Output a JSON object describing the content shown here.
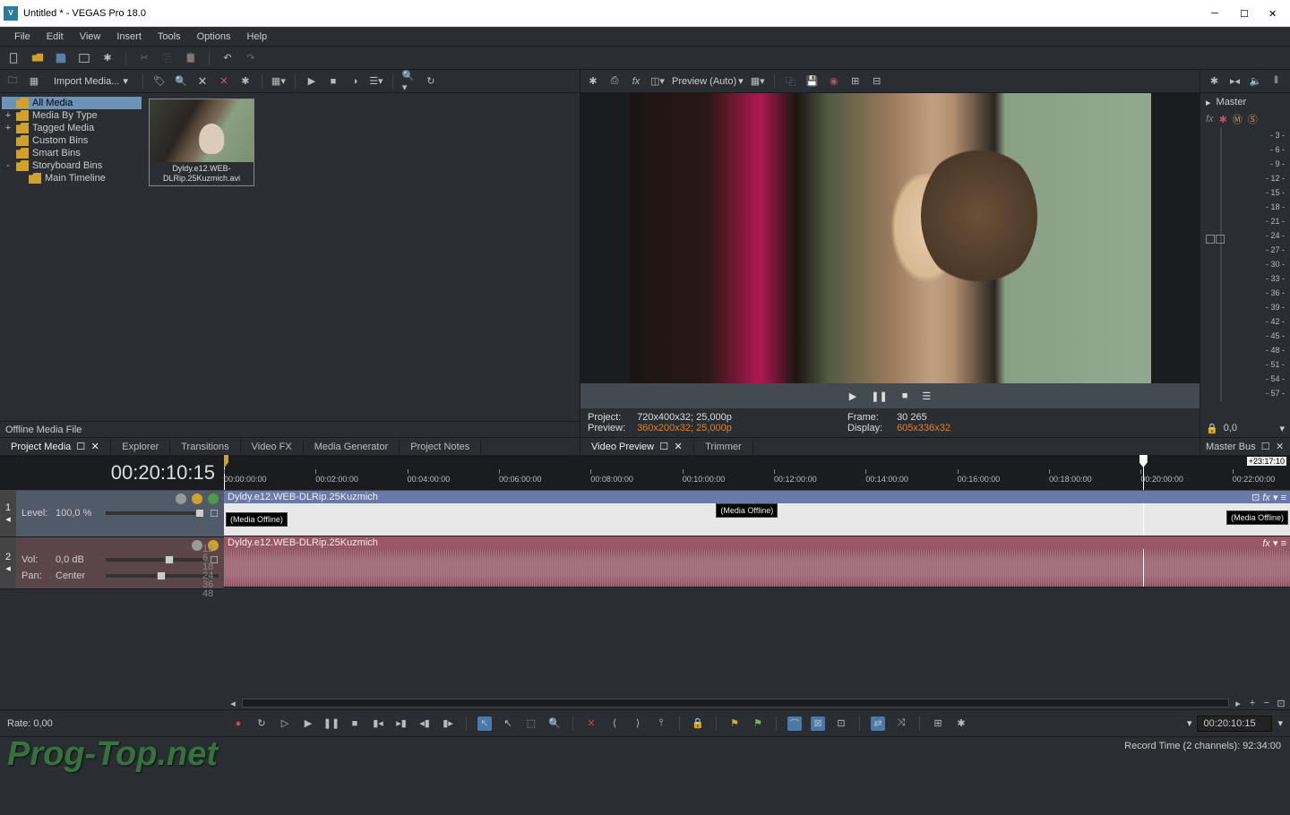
{
  "window": {
    "title": "Untitled * - VEGAS Pro 18.0",
    "app_icon_text": "V"
  },
  "menu": [
    "File",
    "Edit",
    "View",
    "Insert",
    "Tools",
    "Options",
    "Help"
  ],
  "project_media": {
    "import_label": "Import Media...",
    "tree": [
      {
        "label": "All Media",
        "level": 1,
        "sel": true,
        "exp": ""
      },
      {
        "label": "Media By Type",
        "level": 1,
        "exp": "+"
      },
      {
        "label": "Tagged Media",
        "level": 1,
        "exp": "+"
      },
      {
        "label": "Custom Bins",
        "level": 2,
        "exp": ""
      },
      {
        "label": "Smart Bins",
        "level": 2,
        "exp": ""
      },
      {
        "label": "Storyboard Bins",
        "level": 1,
        "exp": "-"
      },
      {
        "label": "Main Timeline",
        "level": 3,
        "exp": ""
      }
    ],
    "thumb_label": "Dyldy.e12.WEB-DLRip.25Kuzmich.avi",
    "footer": "Offline Media File"
  },
  "panel_tabs": [
    "Project Media",
    "Explorer",
    "Transitions",
    "Video FX",
    "Media Generator",
    "Project Notes"
  ],
  "preview": {
    "mode_label": "Preview (Auto)",
    "info": {
      "project_label": "Project:",
      "project_val": "720x400x32; 25,000p",
      "preview_label": "Preview:",
      "preview_val": "360x200x32; 25,000p",
      "frame_label": "Frame:",
      "frame_val": "30 265",
      "display_label": "Display:",
      "display_val": "605x336x32"
    },
    "tabs": [
      "Video Preview",
      "Trimmer"
    ]
  },
  "master": {
    "label": "Master",
    "scale": [
      "- 3 -",
      "- 6 -",
      "- 9 -",
      "- 12 -",
      "- 15 -",
      "- 18 -",
      "- 21 -",
      "- 24 -",
      "- 27 -",
      "- 30 -",
      "- 33 -",
      "- 36 -",
      "- 39 -",
      "- 42 -",
      "- 45 -",
      "- 48 -",
      "- 51 -",
      "- 54 -",
      "- 57 -"
    ],
    "bottom_val": "0,0",
    "tab": "Master Bus"
  },
  "timeline": {
    "timecode": "00:20:10:15",
    "end_tag": "+23:17:10",
    "ruler_ticks": [
      "00:00:00:00",
      "00:02:00:00",
      "00:04:00:00",
      "00:06:00:00",
      "00:08:00:00",
      "00:10:00:00",
      "00:12:00:00",
      "00:14:00:00",
      "00:16:00:00",
      "00:18:00:00",
      "00:20:00:00",
      "00:22:00:00"
    ],
    "video_track": {
      "num": "1",
      "clip_name": "Dyldy.e12.WEB-DLRip.25Kuzmich",
      "level_label": "Level:",
      "level_val": "100,0 %",
      "media_offline": "(Media Offline)"
    },
    "audio_track": {
      "num": "2",
      "clip_name": "Dyldy.e12.WEB-DLRip.25Kuzmich",
      "vol_label": "Vol:",
      "vol_val": "0,0 dB",
      "pan_label": "Pan:",
      "pan_val": "Center",
      "db_labels": [
        "12",
        "6",
        "18",
        "24",
        "36",
        "48"
      ]
    }
  },
  "transport": {
    "rate_label": "Rate: 0,00",
    "time": "00:20:10:15"
  },
  "status": "Record Time (2 channels): 92:34:00",
  "watermark": "Prog-Top.net"
}
